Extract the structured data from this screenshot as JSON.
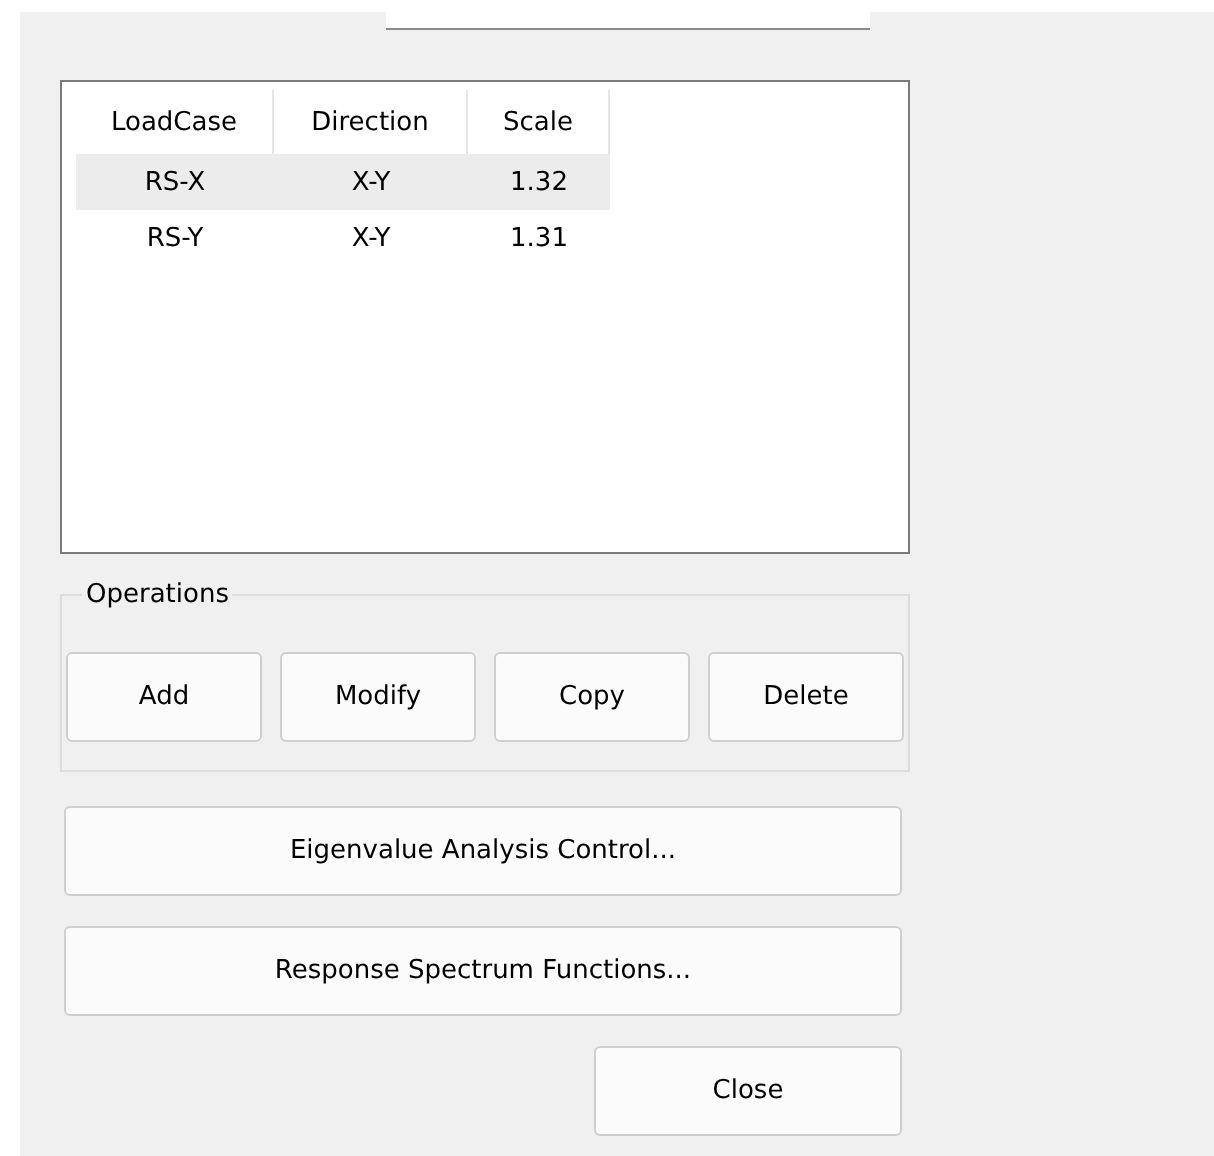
{
  "top_field": {
    "kind": "field"
  },
  "table": {
    "columns": [
      "LoadCase",
      "Direction",
      "Scale"
    ],
    "rows": [
      {
        "cells": [
          "RS-X",
          "X-Y",
          "1.32"
        ],
        "selected": true
      },
      {
        "cells": [
          "RS-Y",
          "X-Y",
          "1.31"
        ],
        "selected": false
      }
    ]
  },
  "operations": {
    "title": "Operations",
    "buttons": [
      "Add",
      "Modify",
      "Copy",
      "Delete"
    ]
  },
  "buttons": [
    "Eigenvalue Analysis Control...",
    "Response Spectrum Functions..."
  ],
  "close_button": "Close"
}
